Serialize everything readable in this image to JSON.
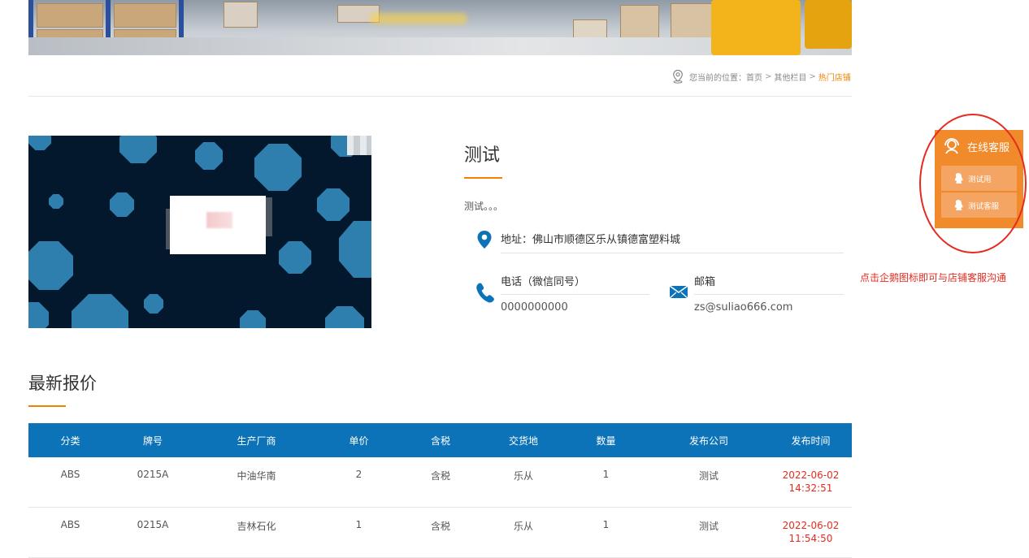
{
  "breadcrumb": {
    "prefix": "您当前的位置：",
    "items": [
      "首页",
      "其他栏目",
      "热门店铺"
    ],
    "separator": ">"
  },
  "shop": {
    "name": "测试",
    "description": "测试。。。",
    "address": "地址：佛山市顺德区乐从镇德富塑料城",
    "phone_label": "电话（微信同号）",
    "phone_value": "0000000000",
    "email_label": "邮箱",
    "email_value": "zs@suliao666.com"
  },
  "service": {
    "title": "在线客服",
    "buttons": [
      "测试用",
      "测试客服"
    ],
    "hint": "点击企鹅图标即可与店铺客服沟通"
  },
  "quotes": {
    "title": "最新报价",
    "columns": [
      "分类",
      "牌号",
      "生产厂商",
      "单价",
      "含税",
      "交货地",
      "数量",
      "发布公司",
      "发布时间"
    ],
    "rows": [
      {
        "category": "ABS",
        "grade": "0215A",
        "maker": "中油华南",
        "price": "2",
        "tax": "含税",
        "place": "乐从",
        "qty": "1",
        "company": "测试",
        "date": "2022-06-02",
        "time": "14:32:51"
      },
      {
        "category": "ABS",
        "grade": "0215A",
        "maker": "吉林石化",
        "price": "1",
        "tax": "含税",
        "place": "乐从",
        "qty": "1",
        "company": "测试",
        "date": "2022-06-02",
        "time": "11:54:50"
      }
    ]
  },
  "colors": {
    "accent": "#f08300",
    "table_header": "#0d73b8",
    "highlight_red": "#e52b20",
    "service_bg": "#f08a2b"
  }
}
